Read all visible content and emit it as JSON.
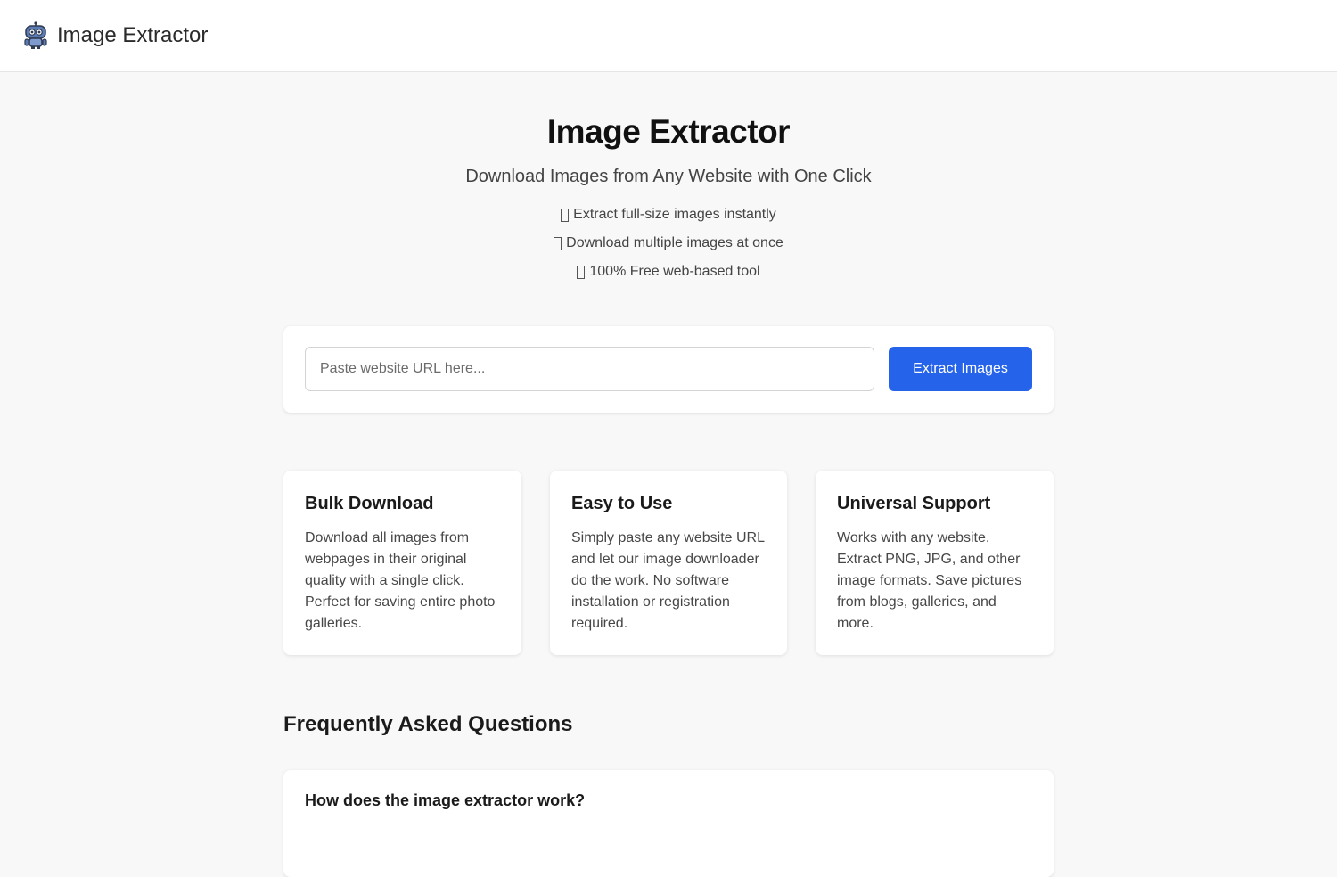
{
  "header": {
    "brand_name": "Image Extractor",
    "logo_icon": "robot-icon"
  },
  "hero": {
    "title": "Image Extractor",
    "subtitle": "Download Images from Any Website with One Click",
    "bullets": [
      "Extract full-size images instantly",
      "Download multiple images at once",
      "100% Free web-based tool"
    ]
  },
  "search": {
    "placeholder": "Paste website URL here...",
    "value": "",
    "button_label": "Extract Images",
    "accent_color": "#2563eb"
  },
  "features": [
    {
      "title": "Bulk Download",
      "description": "Download all images from webpages in their original quality with a single click. Perfect for saving entire photo galleries."
    },
    {
      "title": "Easy to Use",
      "description": "Simply paste any website URL and let our image downloader do the work. No software installation or registration required."
    },
    {
      "title": "Universal Support",
      "description": "Works with any website. Extract PNG, JPG, and other image formats. Save pictures from blogs, galleries, and more."
    }
  ],
  "faq": {
    "heading": "Frequently Asked Questions",
    "items": [
      {
        "question": "How does the image extractor work?"
      }
    ]
  }
}
